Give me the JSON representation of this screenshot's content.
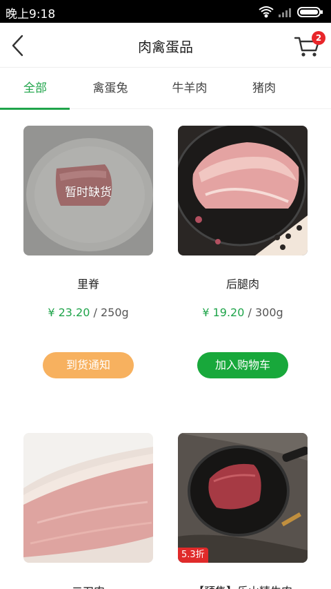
{
  "status_bar": {
    "time": "晚上9:18"
  },
  "header": {
    "title": "肉禽蛋品",
    "cart_count": "2"
  },
  "tabs": [
    {
      "label": "全部",
      "active": true
    },
    {
      "label": "禽蛋兔",
      "active": false
    },
    {
      "label": "牛羊肉",
      "active": false
    },
    {
      "label": "猪肉",
      "active": false
    }
  ],
  "products": [
    {
      "name": "里脊",
      "price": "¥ 23.20",
      "unit": " / 250g",
      "overlay": "暂时缺货",
      "button": "到货通知"
    },
    {
      "name": "后腿肉",
      "price": "¥ 19.20",
      "unit": " / 300g",
      "button": "加入购物车"
    },
    {
      "name": "二刀肉"
    },
    {
      "name": "【预售】乐山精牛肉",
      "discount": "5.3折"
    }
  ],
  "colors": {
    "accent": "#1fa44a",
    "notify": "#f7b15f",
    "add_cart": "#18a83b",
    "badge": "#e8262a"
  }
}
